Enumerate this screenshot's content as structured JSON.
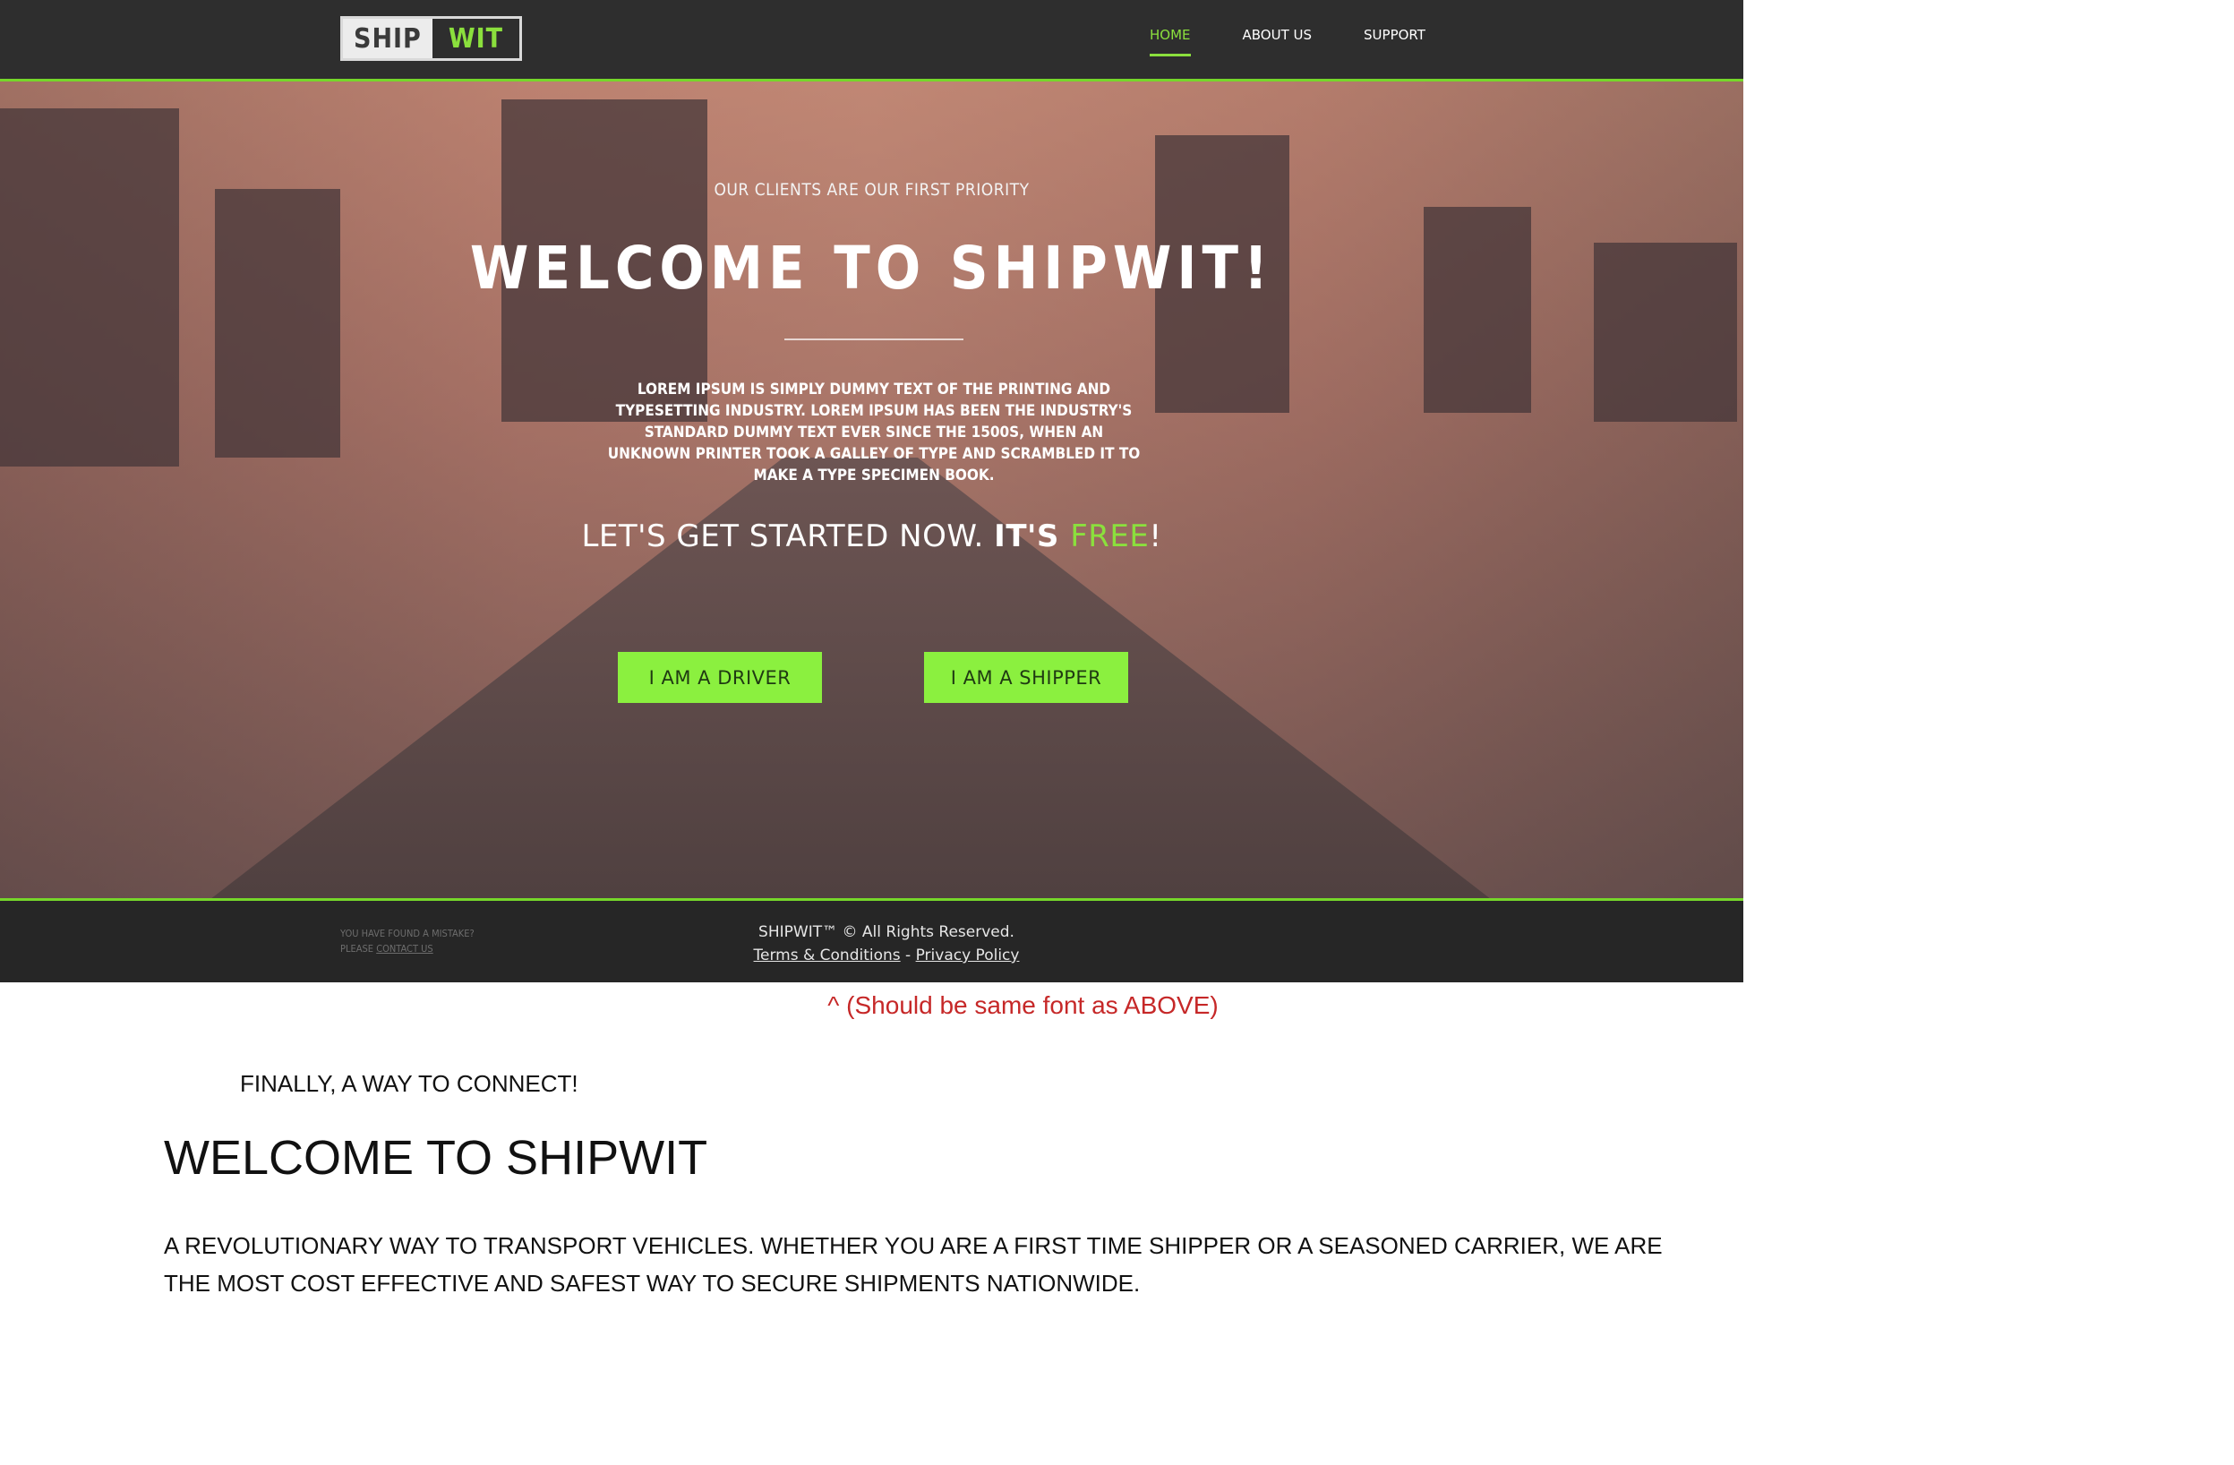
{
  "header": {
    "logo_left": "SHIP",
    "logo_right": "WIT",
    "nav": [
      {
        "label": "HOME",
        "active": true
      },
      {
        "label": "ABOUT US",
        "active": false
      },
      {
        "label": "SUPPORT",
        "active": false
      }
    ]
  },
  "hero": {
    "subtitle": "OUR CLIENTS ARE OUR FIRST PRIORITY",
    "title": "WELCOME TO SHIPWIT!",
    "body": "LOREM IPSUM IS SIMPLY DUMMY TEXT OF THE PRINTING AND TYPESETTING INDUSTRY. LOREM IPSUM HAS BEEN THE INDUSTRY'S STANDARD DUMMY TEXT EVER SINCE THE 1500S, WHEN AN UNKNOWN PRINTER TOOK A GALLEY OF TYPE AND SCRAMBLED IT TO MAKE A TYPE SPECIMEN BOOK.",
    "cta_part1": "LET'S GET STARTED NOW. ",
    "cta_part2": "IT'S ",
    "cta_free": "FREE",
    "cta_end": "!",
    "driver_button": "I AM A DRIVER",
    "shipper_button": "I AM A SHIPPER"
  },
  "footer": {
    "mistake_line1": "YOU HAVE FOUND A MISTAKE?",
    "mistake_line2_prefix": "PLEASE ",
    "contact_link": "CONTACT US",
    "copyright": "SHIPWIT™ © All Rights Reserved.",
    "terms_link": "Terms & Conditions",
    "separator": " - ",
    "privacy_link": "Privacy Policy"
  },
  "annotations": {
    "note": "^ (Should be same font as ABOVE)",
    "finally": "FINALLY, A WAY TO CONNECT!",
    "welcome": "WELCOME TO SHIPWIT",
    "revolution": "A REVOLUTIONARY WAY TO TRANSPORT VEHICLES. WHETHER YOU ARE A FIRST TIME SHIPPER OR A SEASONED CARRIER, WE ARE THE MOST COST EFFECTIVE AND SAFEST WAY TO SECURE SHIPMENTS NATIONWIDE."
  }
}
